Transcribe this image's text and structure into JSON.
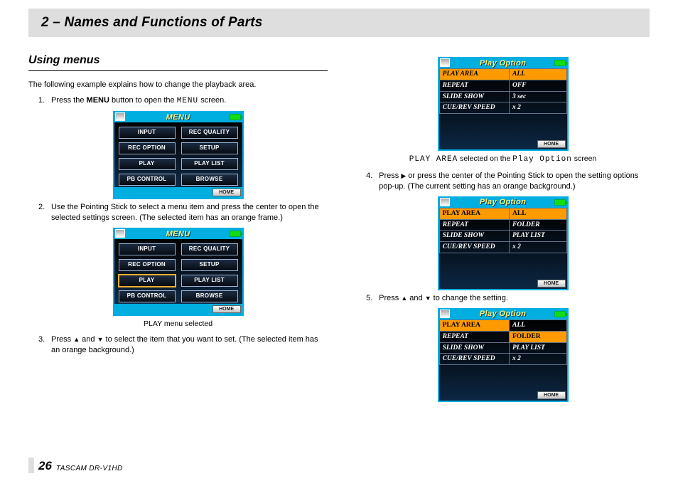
{
  "header": {
    "title": "2 – Names and Functions of Parts"
  },
  "left": {
    "subhead": "Using menus",
    "intro": "The following example explains how to change the playback area.",
    "step1": {
      "num": "1.",
      "a": "Press the ",
      "b": "MENU",
      "c": " button to open the ",
      "d": "MENU",
      "e": " screen."
    },
    "shotMenu": {
      "title": "MENU",
      "btns": [
        "INPUT",
        "REC QUALITY",
        "REC OPTION",
        "SETUP",
        "PLAY",
        "PLAY LIST",
        "PB CONTROL",
        "BROWSE"
      ],
      "home": "HOME"
    },
    "step2": {
      "num": "2.",
      "txt": "Use the Pointing Stick to select a menu item and press the center to open the selected settings screen. (The selected item has an orange frame.)"
    },
    "caption2": "PLAY menu selected",
    "step3": {
      "num": "3.",
      "a": "Press ",
      "up": "▲",
      "mid": " and ",
      "down": "▼",
      "b": " to select the item that you want to set. (The selected item has an orange background.)"
    }
  },
  "right": {
    "shotOpt": {
      "title": "Play Option",
      "rows": [
        {
          "l": "PLAY AREA",
          "r": "ALL"
        },
        {
          "l": "REPEAT",
          "r": "OFF"
        },
        {
          "l": "SLIDE SHOW",
          "r": "3 sec"
        },
        {
          "l": "CUE/REV SPEED",
          "r": "x 2"
        }
      ],
      "home": "HOME"
    },
    "caption3": {
      "a": "PLAY AREA",
      "b": " selected on the ",
      "c": "Play Option",
      "d": " screen"
    },
    "step4": {
      "num": "4.",
      "a": "Press ",
      "play": "▶",
      "b": " or press the center of the Pointing Stick to open the setting options pop-up. (The current setting has an orange background.)"
    },
    "shotOpt2": {
      "title": "Play Option",
      "rows": [
        {
          "l": "PLAY AREA",
          "r": "ALL"
        },
        {
          "l": "REPEAT",
          "r": "FOLDER"
        },
        {
          "l": "SLIDE SHOW",
          "r": "PLAY LIST"
        },
        {
          "l": "CUE/REV SPEED",
          "r": "x 2"
        }
      ],
      "home": "HOME"
    },
    "step5": {
      "num": "5.",
      "a": "Press ",
      "up": "▲",
      "mid": " and ",
      "down": "▼",
      "b": " to change the setting."
    },
    "shotOpt3": {
      "title": "Play Option",
      "rows": [
        {
          "l": "PLAY AREA",
          "r": "ALL"
        },
        {
          "l": "REPEAT",
          "r": "FOLDER"
        },
        {
          "l": "SLIDE SHOW",
          "r": "PLAY LIST"
        },
        {
          "l": "CUE/REV SPEED",
          "r": "x 2"
        }
      ],
      "home": "HOME"
    }
  },
  "footer": {
    "page": "26",
    "model": "TASCAM  DR-V1HD"
  }
}
